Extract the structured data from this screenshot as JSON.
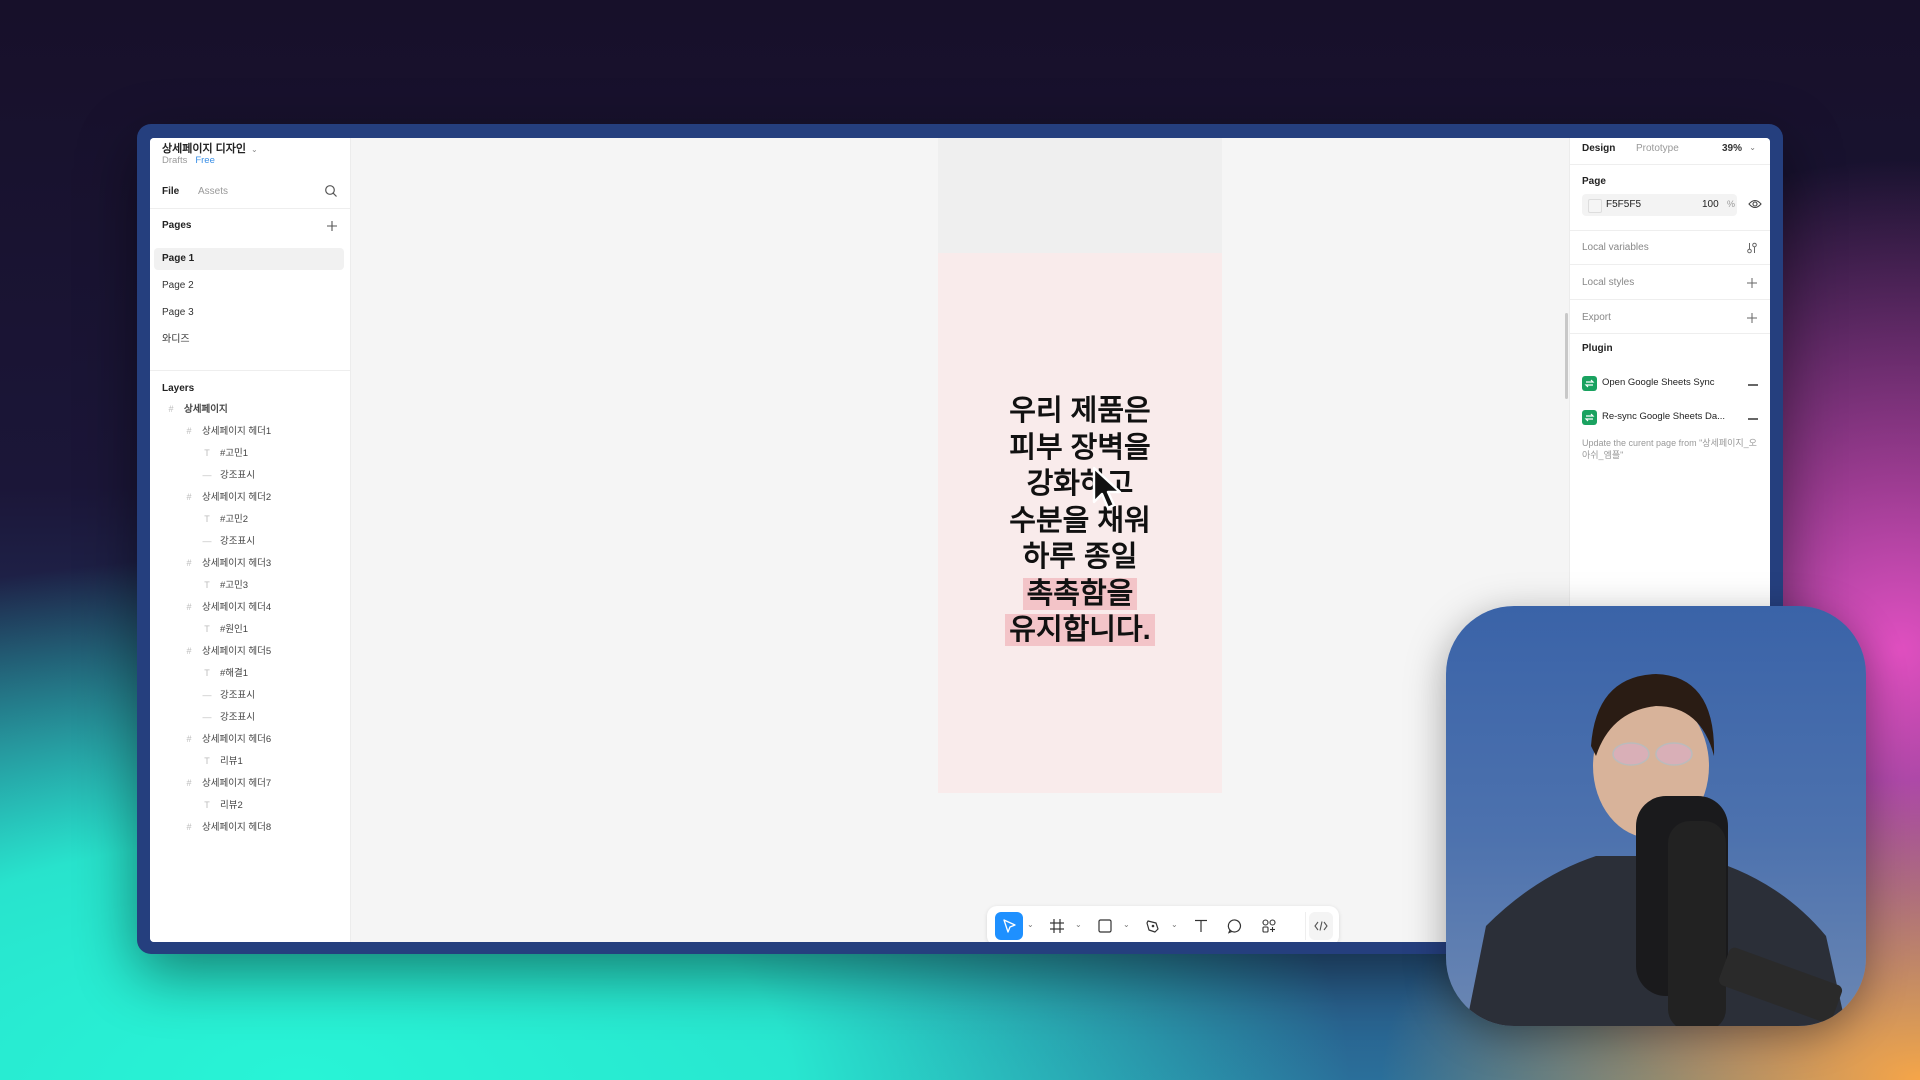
{
  "file": {
    "title": "상세페이지 디자인",
    "location": "Drafts",
    "plan": "Free"
  },
  "left_panel": {
    "tabs": [
      "File",
      "Assets"
    ],
    "pages_header": "Pages",
    "pages": [
      {
        "label": "Page 1",
        "active": true
      },
      {
        "label": "Page 2",
        "active": false
      },
      {
        "label": "Page 3",
        "active": false
      },
      {
        "label": "와디즈",
        "active": false
      }
    ],
    "layers_header": "Layers",
    "layers": [
      {
        "label": "상세페이지",
        "type": "frame",
        "depth": 0
      },
      {
        "label": "상세페이지 헤더1",
        "type": "frame",
        "depth": 1
      },
      {
        "label": "#고민1",
        "type": "text",
        "depth": 2
      },
      {
        "label": "강조표시",
        "type": "line",
        "depth": 2
      },
      {
        "label": "상세페이지 헤더2",
        "type": "frame",
        "depth": 1
      },
      {
        "label": "#고민2",
        "type": "text",
        "depth": 2
      },
      {
        "label": "강조표시",
        "type": "line",
        "depth": 2
      },
      {
        "label": "상세페이지 헤더3",
        "type": "frame",
        "depth": 1
      },
      {
        "label": "#고민3",
        "type": "text",
        "depth": 2
      },
      {
        "label": "상세페이지 헤더4",
        "type": "frame",
        "depth": 1
      },
      {
        "label": "#원인1",
        "type": "text",
        "depth": 2
      },
      {
        "label": "상세페이지 헤더5",
        "type": "frame",
        "depth": 1
      },
      {
        "label": "#해결1",
        "type": "text",
        "depth": 2
      },
      {
        "label": "강조표시",
        "type": "line",
        "depth": 2
      },
      {
        "label": "강조표시",
        "type": "line",
        "depth": 2
      },
      {
        "label": "상세페이지 헤더6",
        "type": "frame",
        "depth": 1
      },
      {
        "label": "리뷰1",
        "type": "text",
        "depth": 2
      },
      {
        "label": "상세페이지 헤더7",
        "type": "frame",
        "depth": 1
      },
      {
        "label": "리뷰2",
        "type": "text",
        "depth": 2
      },
      {
        "label": "상세페이지 헤더8",
        "type": "frame",
        "depth": 1
      }
    ]
  },
  "canvas": {
    "headline_lines": [
      {
        "text": "우리 제품은",
        "highlight": false
      },
      {
        "text": "피부 장벽을",
        "highlight": false
      },
      {
        "text": "강화하고",
        "highlight": false
      },
      {
        "text": "수분을 채워",
        "highlight": false
      },
      {
        "text": "하루 종일",
        "highlight": false
      },
      {
        "text": "촉촉함을",
        "highlight": true
      },
      {
        "text": "유지합니다.",
        "highlight": true
      }
    ],
    "frame_color": "#F9EBEB",
    "highlight_color": "#F3C4C8"
  },
  "toolbar": {
    "tools": [
      "move-tool",
      "frame-tool",
      "shape-tool",
      "pen-tool",
      "text-tool",
      "comment-tool",
      "actions-tool",
      "dev-mode-toggle"
    ],
    "active_tool": "move-tool",
    "accent": "#1E90FF"
  },
  "right_panel": {
    "tabs": [
      "Design",
      "Prototype"
    ],
    "zoom": "39%",
    "page_header": "Page",
    "page_color_hex": "F5F5F5",
    "page_opacity": "100",
    "page_opacity_unit": "%",
    "local_variables": "Local variables",
    "local_styles": "Local styles",
    "export": "Export",
    "plugin_header": "Plugin",
    "plugins": [
      {
        "label": "Open Google Sheets Sync"
      },
      {
        "label": "Re-sync Google Sheets Da..."
      }
    ],
    "plugin_description": "Update the curent page from \"상세페이지_오아쉬_엠플\"",
    "plugin_color": "#1AA260"
  }
}
